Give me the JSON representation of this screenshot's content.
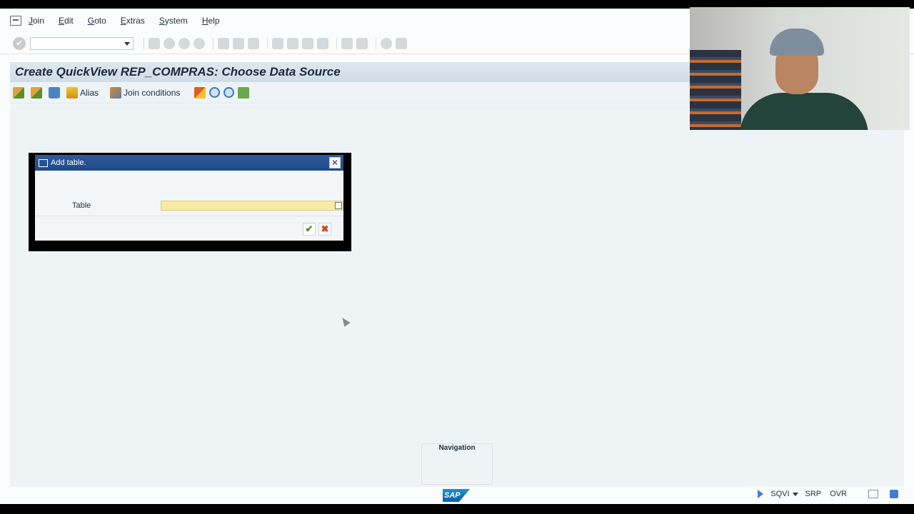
{
  "menu": {
    "items": [
      {
        "label": "Join",
        "key": "J",
        "rest": "oin"
      },
      {
        "label": "Edit",
        "key": "E",
        "rest": "dit"
      },
      {
        "label": "Goto",
        "key": "G",
        "rest": "oto"
      },
      {
        "label": "Extras",
        "key": "E",
        "rest": "xtras"
      },
      {
        "label": "System",
        "key": "S",
        "rest": "ystem"
      },
      {
        "label": "Help",
        "key": "H",
        "rest": "elp"
      }
    ]
  },
  "title": "Create QuickView REP_COMPRAS: Choose Data Source",
  "app_toolbar": {
    "alias_label": "Alias",
    "join_conditions_label": "Join conditions"
  },
  "dialog": {
    "title": "Add table.",
    "close_glyph": "✕",
    "table_label": "Table",
    "table_value": "",
    "ok_glyph": "✔",
    "cancel_glyph": "✖"
  },
  "navigation": {
    "label": "Navigation"
  },
  "status": {
    "logo_text": "SAP",
    "transaction": "SQVI",
    "system": "SRP",
    "mode": "OVR"
  },
  "colors": {
    "title_bar": "#d6e3ee",
    "dialog_header": "#2a5596",
    "required_field": "#f8eaa2"
  }
}
